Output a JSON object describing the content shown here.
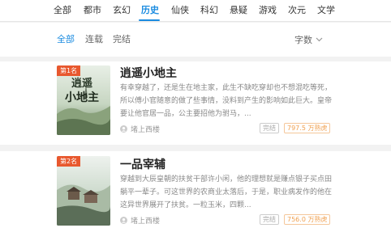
{
  "categories": [
    "全部",
    "都市",
    "玄幻",
    "历史",
    "仙侠",
    "科幻",
    "悬疑",
    "游戏",
    "次元",
    "文学"
  ],
  "active_category": "历史",
  "filters": [
    "全部",
    "连载",
    "完结"
  ],
  "sort_label": "字数",
  "books": [
    {
      "rank": "第1名",
      "title": "逍遥小地主",
      "description": "有幸穿越了，还是生在地主家，此生不缺吃穿却也不想混吃等死，所以傅小官随意的做了些事情，没料到产生的影响如此巨大。皇帝要让他官居一品，公主要招他为驸马，...",
      "author": "堵上西楼",
      "status": "完结",
      "words": "797.5 万熟虎",
      "cover_title": "逍遥小地主"
    },
    {
      "rank": "第2名",
      "title": "一品宰辅",
      "description": "穿越到大辰皇朝的扶贫干部许小闲，他的理想就是赚点银子买点田躺平一辈子。可这世界的农商业太落后，于是，职业病发作的他在这异世界展开了扶贫。一粒玉米，四颗...",
      "author": "堵上西楼",
      "status": "完结",
      "words": "756.0 万熟虎"
    }
  ],
  "colors": {
    "accent": "#1a8be0",
    "rank_badge": "#e8582e",
    "words_tag": "#f0a050"
  },
  "icons": {
    "sort": "chevron-down-icon",
    "author": "user-icon"
  }
}
